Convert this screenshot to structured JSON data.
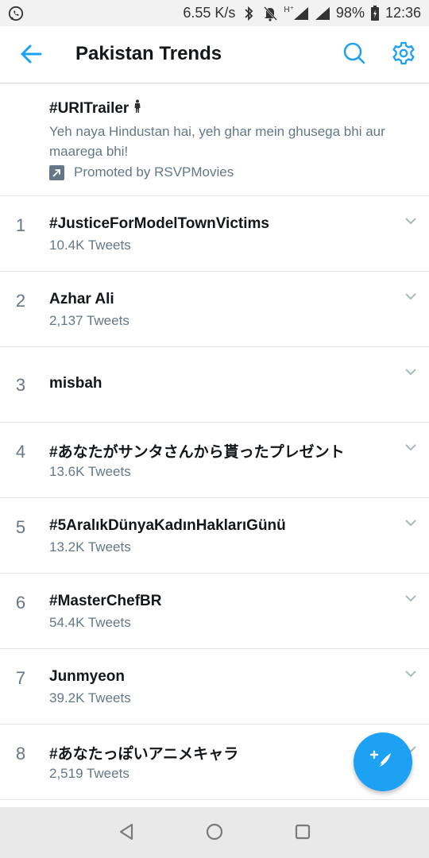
{
  "status_bar": {
    "speed": "6.55 K/s",
    "network": "H⁺",
    "battery": "98%",
    "time": "12:36",
    "icons": [
      "whatsapp-icon",
      "bluetooth-icon",
      "bell-off-icon",
      "signal-icon",
      "battery-icon"
    ]
  },
  "header": {
    "title": "Pakistan Trends",
    "icons": [
      "back-arrow-icon",
      "search-icon",
      "gear-icon"
    ],
    "accent_color": "#1da1f2"
  },
  "promoted": {
    "title": "#URITrailer",
    "description": "Yeh naya Hindustan hai, yeh ghar mein ghusega bhi aur maarega bhi!",
    "promoted_by": "Promoted by RSVPMovies"
  },
  "trends": [
    {
      "rank": "1",
      "name": "#JusticeForModelTownVictims",
      "count": "10.4K Tweets"
    },
    {
      "rank": "2",
      "name": "Azhar Ali",
      "count": "2,137 Tweets"
    },
    {
      "rank": "3",
      "name": "misbah",
      "count": ""
    },
    {
      "rank": "4",
      "name": "#あなたがサンタさんから貰ったプレゼント",
      "count": "13.6K Tweets"
    },
    {
      "rank": "5",
      "name": "#5AralıkDünyaKadınHaklarıGünü",
      "count": "13.2K Tweets"
    },
    {
      "rank": "6",
      "name": "#MasterChefBR",
      "count": "54.4K Tweets"
    },
    {
      "rank": "7",
      "name": "Junmyeon",
      "count": "39.2K Tweets"
    },
    {
      "rank": "8",
      "name": "#あなたっぽいアニメキャラ",
      "count": "2,519 Tweets"
    }
  ],
  "fab": {
    "icon": "compose-tweet-icon"
  },
  "nav": {
    "icons": [
      "nav-back-icon",
      "nav-home-icon",
      "nav-recents-icon"
    ]
  }
}
